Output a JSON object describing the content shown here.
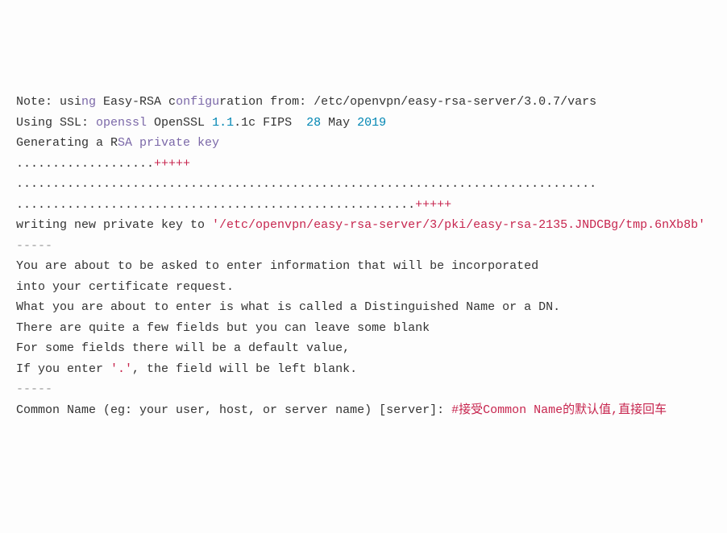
{
  "l1": {
    "a": "Note: usi",
    "b": "ng",
    "c": " Easy-RSA c",
    "d": "onfigu",
    "e": "ration from: /etc/openvpn/easy-rsa-server/3.0.7/vars"
  },
  "l2": {
    "a": "Using SSL: ",
    "b": "openssl",
    "c": " OpenSSL ",
    "d": "1.1",
    "e": ".1c FIPS  ",
    "f": "28",
    "g": " May ",
    "h": "2019"
  },
  "l3": {
    "a": "Generating a R",
    "b": "SA private key"
  },
  "l4": {
    "a": "...................",
    "b": "+++++"
  },
  "l5": "................................................................................",
  "l6": {
    "a": ".......................................................",
    "b": "+++++"
  },
  "l7": {
    "a": "writing new private key to ",
    "b": "'/etc/openvpn/easy-rsa-server/3/pki/easy-rsa-2135.JNDCBg/tmp.6nXb8b'"
  },
  "l8": "-----",
  "l9": "You are about to be asked to enter information that will be incorporated",
  "l10": "into your certificate request.",
  "l11": "What you are about to enter is what is called a Distinguished Name or a DN.",
  "l12": "There are quite a few fields but you can leave some blank",
  "l13": "For some fields there will be a default value,",
  "l14": {
    "a": "If you enter ",
    "b": "'.'",
    "c": ", the field will be left blank."
  },
  "l15": "-----",
  "l16": {
    "a": "Common Name (eg: your user, host, or server name) [server]: ",
    "b": "#接受Common Name的默认值,直接回车"
  }
}
